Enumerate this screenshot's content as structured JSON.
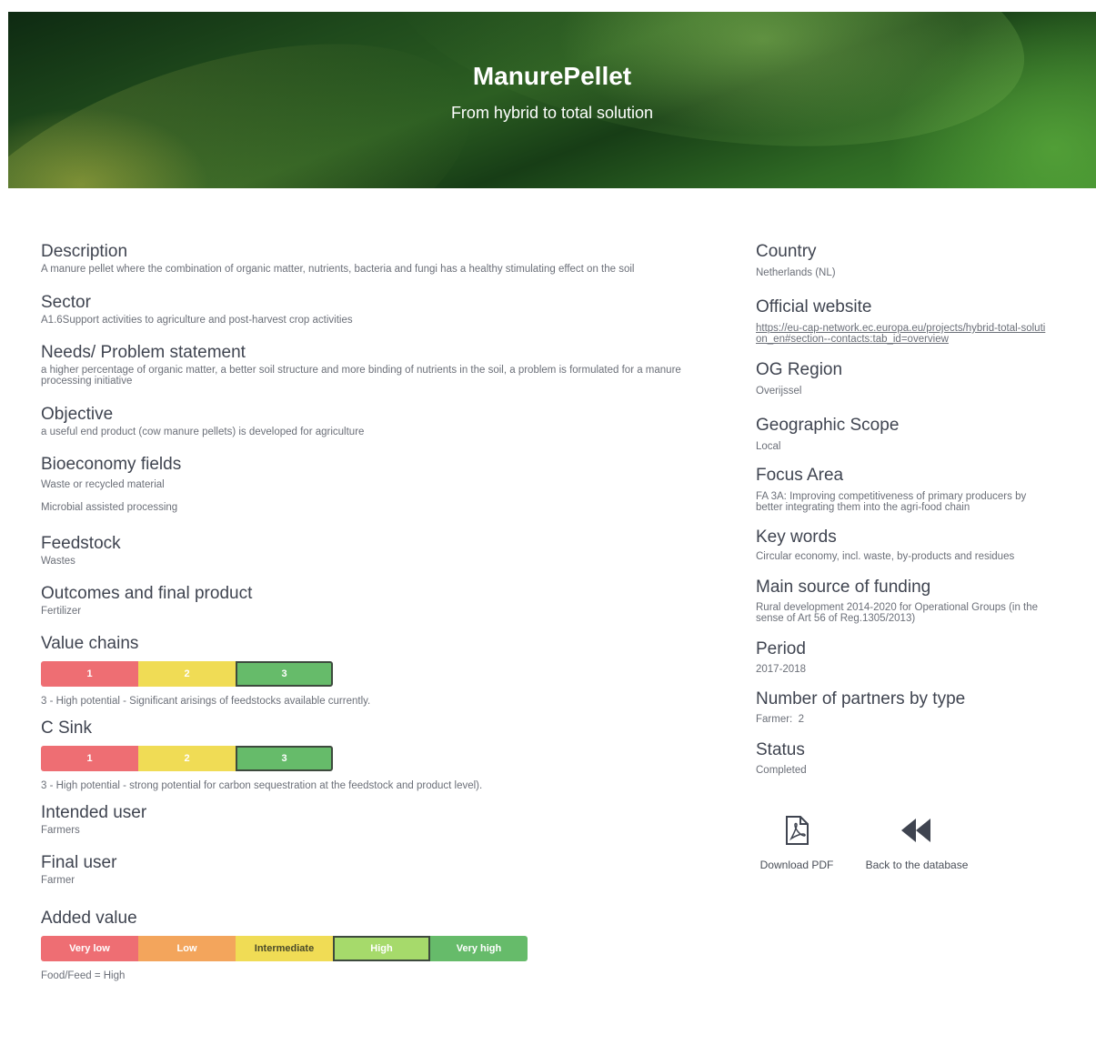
{
  "hero": {
    "title": "ManurePellet",
    "subtitle": "From hybrid to total solution"
  },
  "left": {
    "description": {
      "heading": "Description",
      "text": "A manure pellet where the combination of organic matter, nutrients, bacteria and fungi has a healthy stimulating effect on the soil"
    },
    "sector": {
      "heading": "Sector",
      "text": "A1.6Support activities to agriculture and post-harvest crop activities"
    },
    "needs": {
      "heading": "Needs/ Problem statement",
      "text": "a higher percentage of organic matter, a better soil structure and more binding of nutrients in the soil, a problem is formulated for a manure processing initiative"
    },
    "objective": {
      "heading": "Objective",
      "text": "a useful end product (cow manure pellets) is developed for agriculture"
    },
    "bioeconomy": {
      "heading": "Bioeconomy fields",
      "items": [
        "Waste or recycled material",
        "Microbial assisted processing"
      ]
    },
    "feedstock": {
      "heading": "Feedstock",
      "text": "Wastes"
    },
    "outcomes": {
      "heading": "Outcomes and final product",
      "text": "Fertilizer"
    },
    "value_chains": {
      "heading": "Value chains",
      "scale": [
        "1",
        "2",
        "3"
      ],
      "selected": 3,
      "note": "3 - High potential - Significant arisings of feedstocks available currently."
    },
    "c_sink": {
      "heading": "C Sink",
      "scale": [
        "1",
        "2",
        "3"
      ],
      "selected": 3,
      "note": "3 - High potential - strong potential for carbon sequestration at the feedstock and product level)."
    },
    "intended_user": {
      "heading": "Intended user",
      "text": "Farmers"
    },
    "final_user": {
      "heading": "Final user",
      "text": "Farmer"
    },
    "added_value": {
      "heading": "Added value",
      "scale": [
        "Very low",
        "Low",
        "Intermediate",
        "High",
        "Very high"
      ],
      "selected": 4,
      "note": "Food/Feed = High"
    }
  },
  "right": {
    "country": {
      "heading": "Country",
      "text": "Netherlands (NL)"
    },
    "website": {
      "heading": "Official website",
      "text": "https://eu-cap-network.ec.europa.eu/projects/hybrid-total-solution_en#section--contacts:tab_id=overview"
    },
    "og_region": {
      "heading": "OG Region",
      "text": "Overijssel"
    },
    "geo_scope": {
      "heading": "Geographic Scope",
      "text": "Local"
    },
    "focus_area": {
      "heading": "Focus Area",
      "text": "FA 3A: Improving competitiveness of primary producers by better integrating them into the agri-food chain"
    },
    "keywords": {
      "heading": "Key words",
      "text": "Circular economy, incl. waste, by-products and residues"
    },
    "funding": {
      "heading": "Main source of funding",
      "text": "Rural development 2014-2020 for Operational Groups (in the sense of Art 56 of Reg.1305/2013)"
    },
    "period": {
      "heading": "Period",
      "text": "2017-2018"
    },
    "partners": {
      "heading": "Number of partners by type",
      "text": "Farmer:  2"
    },
    "status": {
      "heading": "Status",
      "text": "Completed"
    },
    "download_label": "Download PDF",
    "back_label": "Back to the database"
  },
  "colors": {
    "red": "#ee6e73",
    "orange": "#f3a55c",
    "yellow": "#f0dc55",
    "light_green": "#a6da6b",
    "green": "#66bb6a"
  }
}
